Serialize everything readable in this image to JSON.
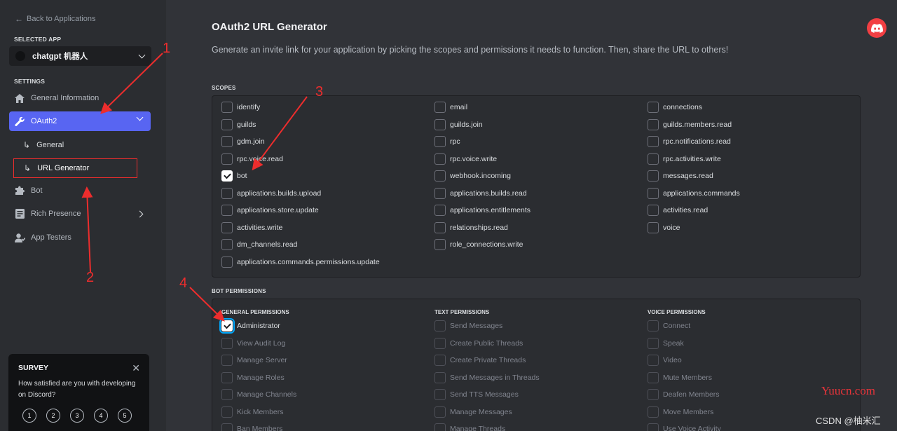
{
  "sidebar": {
    "back_label": "Back to Applications",
    "selected_app_label": "SELECTED APP",
    "app_name": "chatgpt 机器人",
    "settings_label": "SETTINGS",
    "items": [
      {
        "label": "General Information",
        "icon": "home-icon"
      },
      {
        "label": "OAuth2",
        "icon": "wrench-icon",
        "active": true
      },
      {
        "label": "General",
        "sub": true
      },
      {
        "label": "URL Generator",
        "sub": true
      },
      {
        "label": "Bot",
        "icon": "puzzle-icon"
      },
      {
        "label": "Rich Presence",
        "icon": "document-icon"
      },
      {
        "label": "App Testers",
        "icon": "user-icon"
      }
    ],
    "survey": {
      "title": "SURVEY",
      "question": "How satisfied are you with developing on Discord?",
      "ratings": [
        "1",
        "2",
        "3",
        "4",
        "5"
      ]
    }
  },
  "main": {
    "title": "OAuth2 URL Generator",
    "description": "Generate an invite link for your application by picking the scopes and permissions it needs to function. Then, share the URL to others!",
    "scopes_label": "SCOPES",
    "scopes": [
      [
        "identify",
        "email",
        "connections"
      ],
      [
        "guilds",
        "guilds.join",
        "guilds.members.read"
      ],
      [
        "gdm.join",
        "rpc",
        "rpc.notifications.read"
      ],
      [
        "rpc.voice.read",
        "rpc.voice.write",
        "rpc.activities.write"
      ],
      [
        "bot",
        "webhook.incoming",
        "messages.read"
      ],
      [
        "applications.builds.upload",
        "applications.builds.read",
        "applications.commands"
      ],
      [
        "applications.store.update",
        "applications.entitlements",
        "activities.read"
      ],
      [
        "activities.write",
        "relationships.read",
        "voice"
      ],
      [
        "dm_channels.read",
        "role_connections.write"
      ],
      [
        "applications.commands.permissions.update"
      ]
    ],
    "checked_scope": "bot",
    "bot_permissions_label": "BOT PERMISSIONS",
    "permission_columns": [
      {
        "title": "GENERAL PERMISSIONS",
        "items": [
          "Administrator",
          "View Audit Log",
          "Manage Server",
          "Manage Roles",
          "Manage Channels",
          "Kick Members",
          "Ban Members"
        ]
      },
      {
        "title": "TEXT PERMISSIONS",
        "items": [
          "Send Messages",
          "Create Public Threads",
          "Create Private Threads",
          "Send Messages in Threads",
          "Send TTS Messages",
          "Manage Messages",
          "Manage Threads"
        ]
      },
      {
        "title": "VOICE PERMISSIONS",
        "items": [
          "Connect",
          "Speak",
          "Video",
          "Mute Members",
          "Deafen Members",
          "Move Members",
          "Use Voice Activity"
        ]
      }
    ],
    "checked_permission": "Administrator"
  },
  "annotations": {
    "numbers": [
      "1",
      "2",
      "3",
      "4"
    ],
    "watermark_site": "Yuucn.com",
    "watermark_author": "CSDN @柚米汇"
  },
  "colors": {
    "accent": "#5865f2",
    "annotation": "#ed2d2d",
    "discord_logo": "#f23f43"
  }
}
